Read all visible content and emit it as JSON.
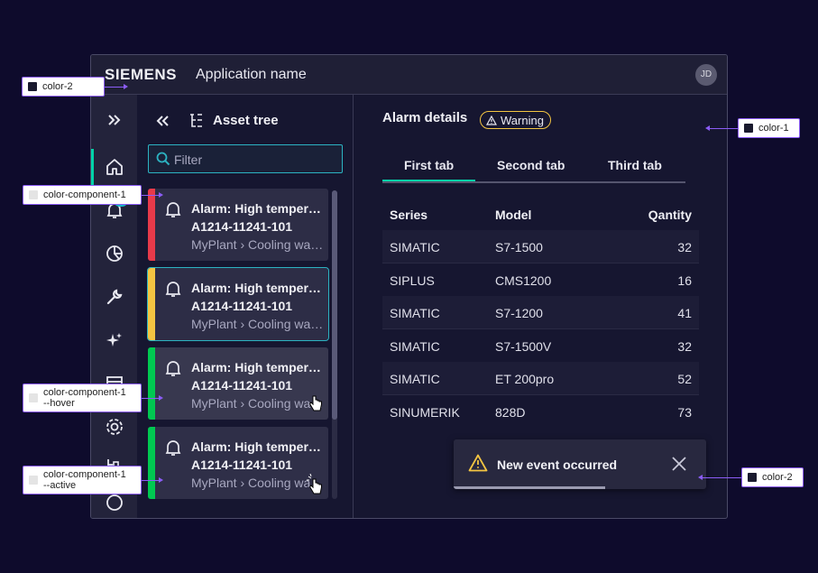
{
  "header": {
    "brand": "SIEMENS",
    "app_name": "Application name",
    "user_initials": "JD"
  },
  "sidebar": {
    "items": [
      {
        "icon": "double-chevron-right-icon"
      },
      {
        "icon": "home-icon",
        "active": true
      },
      {
        "icon": "bell-icon"
      },
      {
        "icon": "pie-chart-icon"
      },
      {
        "icon": "wrench-icon"
      },
      {
        "icon": "sparkle-icon"
      },
      {
        "icon": "layout-icon"
      },
      {
        "icon": "settings-icon"
      },
      {
        "icon": "hierarchy-icon"
      }
    ]
  },
  "tree": {
    "title": "Asset tree",
    "filter_placeholder": "Filter",
    "cards": [
      {
        "title": "Alarm: High temperature",
        "id": "A1214-11241-101",
        "path": "MyPlant › Cooling water system",
        "status_color": "#e83a4a"
      },
      {
        "title": "Alarm: High temperature",
        "id": "A1214-11241-101",
        "path": "MyPlant › Cooling water system",
        "status_color": "#f4c542"
      },
      {
        "title": "Alarm: High temperature",
        "id": "A1214-11241-101",
        "path": "MyPlant › Cooling water system",
        "status_color": "#00c851"
      },
      {
        "title": "Alarm: High temperature",
        "id": "A1214-11241-101",
        "path": "MyPlant › Cooling water system",
        "status_color": "#00c851"
      }
    ]
  },
  "details": {
    "title": "Alarm details",
    "status_badge": "Warning",
    "tabs": [
      "First tab",
      "Second tab",
      "Third tab"
    ],
    "active_tab": 0,
    "table": {
      "headers": [
        "Series",
        "Model",
        "Qantity"
      ],
      "rows": [
        [
          "SIMATIC",
          "S7-1500",
          "32"
        ],
        [
          "SIPLUS",
          "CMS1200",
          "16"
        ],
        [
          "SIMATIC",
          "S7-1200",
          "41"
        ],
        [
          "SIMATIC",
          "S7-1500V",
          "32"
        ],
        [
          "SIMATIC",
          "ET 200pro",
          "52"
        ],
        [
          "SINUMERIK",
          "828D",
          "73"
        ]
      ]
    }
  },
  "toast": {
    "message": "New event occurred",
    "progress": 0.6
  },
  "annotations": [
    {
      "label": "color-2",
      "swatch": "#1a1a2e"
    },
    {
      "label": "color-1",
      "swatch": "#1a1a2e"
    },
    {
      "label": "color-component-1",
      "swatch": "#e4e4e4"
    },
    {
      "label": "color-component-1\n--hover",
      "swatch": "#e4e4e4"
    },
    {
      "label": "color-component-1\n--active",
      "swatch": "#e4e4e4"
    },
    {
      "label": "color-2",
      "swatch": "#1a1a2e"
    }
  ],
  "colors": {
    "accent": "#00d2a8",
    "focus": "#2cb3c2",
    "annotation": "#8b5cf6",
    "warning": "#f4c542"
  }
}
